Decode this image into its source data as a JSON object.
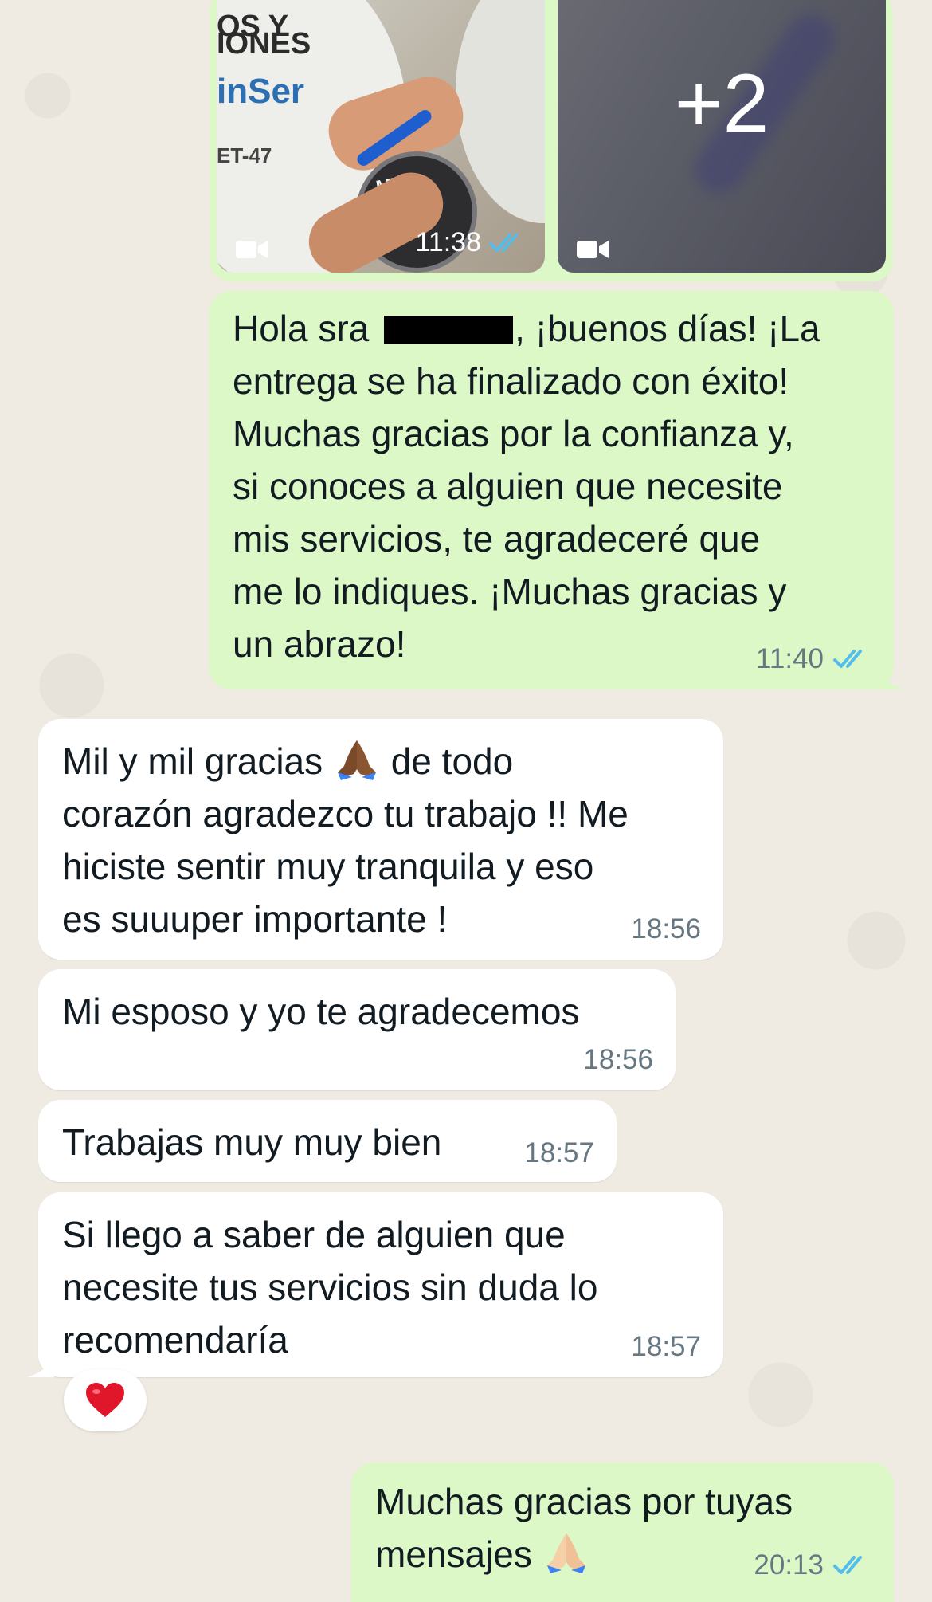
{
  "chat": {
    "media_message": {
      "time": "11:38",
      "status": "read",
      "tile_left_labels": {
        "line1": "OS Y",
        "line2": "IONES",
        "brand": "inSer",
        "tag": "ET-47",
        "lid": "MVE"
      },
      "more_count": "+2"
    },
    "messages": [
      {
        "id": "out-1",
        "direction": "outgoing",
        "before_redaction": "Hola sra ",
        "after_redaction": ", ¡buenos días! ¡La\nentrega se ha finalizado con éxito!\nMuchas gracias por la confianza y,\nsi conoces a alguien que necesite\nmis servicios, te agradeceré que\nme lo indiques. ¡Muchas gracias y\nun abrazo!",
        "time": "11:40",
        "status": "read"
      },
      {
        "id": "in-1",
        "direction": "incoming",
        "text_before_emoji": "Mil y mil gracias ",
        "emoji": "folded-hands-dark",
        "text_after_emoji": " de todo\ncorazón agradezco tu trabajo !! Me\nhiciste sentir muy tranquila y eso\nes suuuper importante !",
        "time": "18:56"
      },
      {
        "id": "in-2",
        "direction": "incoming",
        "text": "Mi esposo y yo te agradecemos",
        "time": "18:56"
      },
      {
        "id": "in-3",
        "direction": "incoming",
        "text": "Trabajas muy muy bien",
        "time": "18:57"
      },
      {
        "id": "in-4",
        "direction": "incoming",
        "text": "Si llego a saber de alguien que\nnecesite tus servicios sin duda lo\nrecomendaría",
        "time": "18:57",
        "reaction": "heart"
      },
      {
        "id": "out-2",
        "direction": "outgoing",
        "text_before_emoji": "Muchas gracias por tuyas\nmensajes ",
        "emoji": "folded-hands-light",
        "time": "20:13",
        "status": "read"
      }
    ]
  },
  "colors": {
    "outgoing_bubble": "#dcf8c6",
    "incoming_bubble": "#ffffff",
    "wallpaper": "#efeae2",
    "read_tick": "#53bdeb",
    "timestamp": "#667781"
  }
}
